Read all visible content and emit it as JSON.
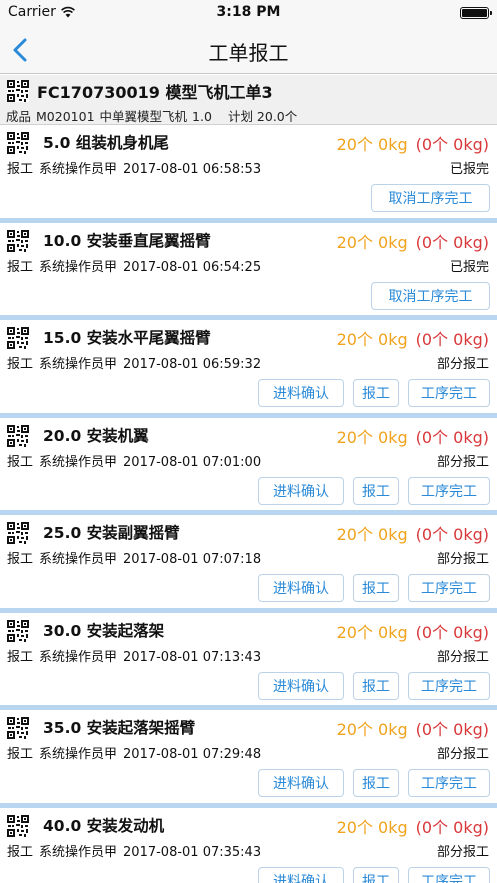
{
  "status_bar": {
    "carrier": "Carrier",
    "time": "3:18 PM"
  },
  "nav": {
    "title": "工单报工"
  },
  "order": {
    "title": "FC170730019 模型飞机工单3",
    "product_type": "成品",
    "product_code": "M020101",
    "product_name": "中单翼模型飞机",
    "version": "1.0",
    "plan": "计划 20.0个"
  },
  "labels": {
    "report": "报工",
    "cancel_finish": "取消工序完工",
    "feed_confirm": "进料确认",
    "report_btn": "报工",
    "finish": "工序完工"
  },
  "operations": [
    {
      "title": "5.0 组装机身机尾",
      "qty": "20个 0kg",
      "qty_ng": "(0个 0kg)",
      "operator": "系统操作员甲",
      "datetime": "2017-08-01 06:58:53",
      "status": "已报完"
    },
    {
      "title": "10.0 安装垂直尾翼摇臂",
      "qty": "20个 0kg",
      "qty_ng": "(0个 0kg)",
      "operator": "系统操作员甲",
      "datetime": "2017-08-01 06:54:25",
      "status": "已报完"
    },
    {
      "title": "15.0 安装水平尾翼摇臂",
      "qty": "20个 0kg",
      "qty_ng": "(0个 0kg)",
      "operator": "系统操作员甲",
      "datetime": "2017-08-01 06:59:32",
      "status": "部分报工"
    },
    {
      "title": "20.0 安装机翼",
      "qty": "20个 0kg",
      "qty_ng": "(0个 0kg)",
      "operator": "系统操作员甲",
      "datetime": "2017-08-01 07:01:00",
      "status": "部分报工"
    },
    {
      "title": "25.0 安装副翼摇臂",
      "qty": "20个 0kg",
      "qty_ng": "(0个 0kg)",
      "operator": "系统操作员甲",
      "datetime": "2017-08-01 07:07:18",
      "status": "部分报工"
    },
    {
      "title": "30.0 安装起落架",
      "qty": "20个 0kg",
      "qty_ng": "(0个 0kg)",
      "operator": "系统操作员甲",
      "datetime": "2017-08-01 07:13:43",
      "status": "部分报工"
    },
    {
      "title": "35.0 安装起落架摇臂",
      "qty": "20个 0kg",
      "qty_ng": "(0个 0kg)",
      "operator": "系统操作员甲",
      "datetime": "2017-08-01 07:29:48",
      "status": "部分报工"
    },
    {
      "title": "40.0 安装发动机",
      "qty": "20个 0kg",
      "qty_ng": "(0个 0kg)",
      "operator": "系统操作员甲",
      "datetime": "2017-08-01 07:35:43",
      "status": "部分报工"
    }
  ],
  "colors": {
    "qty": "#f0a31d",
    "qty_ng": "#d9383a",
    "accent": "#2a8ad8",
    "separator": "#b9d6f0"
  }
}
